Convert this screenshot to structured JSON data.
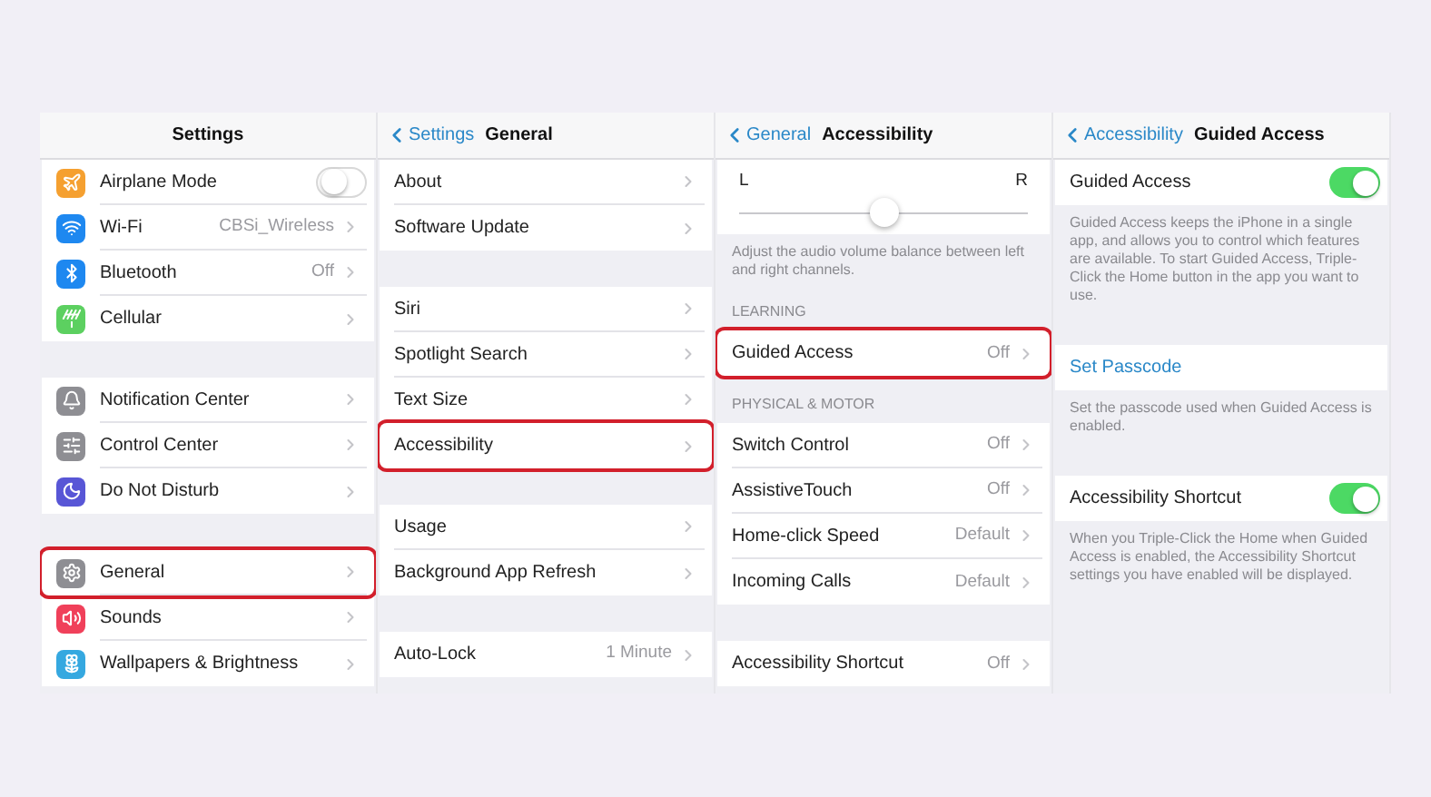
{
  "panels": [
    {
      "header": {
        "title": "Settings"
      },
      "sections": [
        {
          "kind": "group",
          "rows": [
            {
              "kind": "toggle",
              "label": "Airplane Mode",
              "on": false,
              "color": "#f5a030",
              "highlighted": false
            },
            {
              "kind": "nav",
              "label": "Wi-Fi",
              "value": "CBSi_Wireless",
              "color": "#1e88f0",
              "highlighted": false
            },
            {
              "kind": "nav",
              "label": "Bluetooth",
              "value": "Off",
              "color": "#1e88f0",
              "highlighted": false
            },
            {
              "kind": "nav",
              "label": "Cellular",
              "color": "#5cd060",
              "highlighted": false
            }
          ]
        },
        {
          "kind": "group",
          "rows": [
            {
              "kind": "nav",
              "label": "Notification Center",
              "color": "#8e8e93",
              "highlighted": false
            },
            {
              "kind": "nav",
              "label": "Control Center",
              "color": "#8e8e93",
              "highlighted": false
            },
            {
              "kind": "nav",
              "label": "Do Not Disturb",
              "color": "#5856d6",
              "highlighted": false
            }
          ]
        },
        {
          "kind": "group",
          "rows": [
            {
              "kind": "nav",
              "label": "General",
              "color": "#8e8e93",
              "highlighted": true
            },
            {
              "kind": "nav",
              "label": "Sounds",
              "color": "#f0405a",
              "highlighted": false
            },
            {
              "kind": "nav",
              "label": "Wallpapers & Brightness",
              "color": "#35a8e0",
              "highlighted": false
            }
          ]
        }
      ]
    },
    {
      "header": {
        "back": "Settings",
        "title": "General"
      },
      "sections": [
        {
          "kind": "group",
          "rows": [
            {
              "kind": "nav",
              "label": "About",
              "highlighted": false
            },
            {
              "kind": "nav",
              "label": "Software Update",
              "highlighted": false
            }
          ]
        },
        {
          "kind": "group",
          "rows": [
            {
              "kind": "nav",
              "label": "Siri",
              "highlighted": false
            },
            {
              "kind": "nav",
              "label": "Spotlight Search",
              "highlighted": false
            },
            {
              "kind": "nav",
              "label": "Text Size",
              "highlighted": false
            },
            {
              "kind": "nav",
              "label": "Accessibility",
              "highlighted": true
            }
          ]
        },
        {
          "kind": "group",
          "rows": [
            {
              "kind": "nav",
              "label": "Usage",
              "highlighted": false
            },
            {
              "kind": "nav",
              "label": "Background App Refresh",
              "highlighted": false
            }
          ]
        },
        {
          "kind": "group",
          "rows": [
            {
              "kind": "nav",
              "label": "Auto-Lock",
              "value": "1 Minute",
              "highlighted": false
            }
          ]
        }
      ]
    },
    {
      "header": {
        "back": "General",
        "title": "Accessibility"
      },
      "sections": [
        {
          "kind": "slider",
          "left_label": "L",
          "right_label": "R",
          "level": 0.5
        },
        {
          "kind": "note",
          "text": "Adjust the audio volume balance between left and right channels."
        },
        {
          "kind": "caption",
          "text": "LEARNING"
        },
        {
          "kind": "group",
          "rows": [
            {
              "kind": "nav",
              "label": "Guided Access",
              "value": "Off",
              "highlighted": true
            }
          ]
        },
        {
          "kind": "caption",
          "text": "PHYSICAL & MOTOR"
        },
        {
          "kind": "group",
          "rows": [
            {
              "kind": "nav",
              "label": "Switch Control",
              "value": "Off",
              "highlighted": false
            },
            {
              "kind": "nav",
              "label": "AssistiveTouch",
              "value": "Off",
              "highlighted": false
            },
            {
              "kind": "nav",
              "label": "Home-click Speed",
              "value": "Default",
              "highlighted": false
            },
            {
              "kind": "nav",
              "label": "Incoming Calls",
              "value": "Default",
              "highlighted": false
            }
          ]
        },
        {
          "kind": "group",
          "rows": [
            {
              "kind": "nav",
              "label": "Accessibility Shortcut",
              "value": "Off",
              "highlighted": false
            }
          ]
        }
      ]
    },
    {
      "header": {
        "back": "Accessibility",
        "title": "Guided Access"
      },
      "sections": [
        {
          "kind": "group",
          "rows": [
            {
              "kind": "toggle",
              "label": "Guided Access",
              "on": true,
              "highlighted": false
            }
          ]
        },
        {
          "kind": "note",
          "text": "Guided Access keeps the iPhone in a single app, and allows you to control which features are available. To start Guided Access, Triple-Click the Home button in the app you want to use."
        },
        {
          "kind": "group",
          "rows": [
            {
              "kind": "link",
              "label": "Set Passcode",
              "highlighted": false
            }
          ]
        },
        {
          "kind": "note",
          "text": "Set the passcode used when Guided Access is enabled."
        },
        {
          "kind": "group",
          "rows": [
            {
              "kind": "toggle",
              "label": "Accessibility Shortcut",
              "on": true,
              "highlighted": false
            }
          ]
        },
        {
          "kind": "note",
          "text": "When you Triple-Click the Home when Guided Access is enabled, the Accessibility Shortcut settings you have enabled will be displayed."
        }
      ]
    }
  ]
}
